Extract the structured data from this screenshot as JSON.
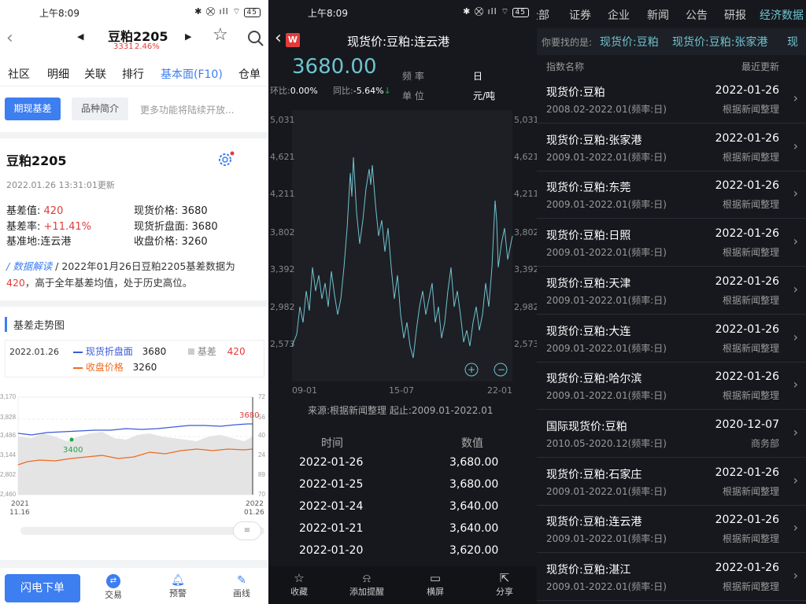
{
  "status": {
    "time": "上午8:09",
    "icons": "✱ ⛒ ıll ⌔",
    "battery": "45"
  },
  "p1": {
    "title": "豆粕2205",
    "price": "3331",
    "change": "2.46%",
    "tabs": [
      "社区",
      "明细",
      "关联",
      "排行",
      "基本面(F10)",
      "仓单"
    ],
    "subbtns": [
      "期现基差",
      "品种简介"
    ],
    "more": "更多功能将陆续开放...",
    "heading": "豆粕2205",
    "updated": "2022.01.26 13:31:01更新",
    "kv": {
      "basis_label": "基差值:",
      "basis": "420",
      "rate_label": "基差率:",
      "rate": "+11.41%",
      "place_label": "基准地:",
      "place": "连云港",
      "spot_label": "现货价格:",
      "spot": "3680",
      "spot_disc_label": "现货折盘面:",
      "spot_disc": "3680",
      "close_label": "收盘价格:",
      "close": "3260"
    },
    "analysis_label": "数据解读",
    "analysis_text": "2022年01月26日豆粕2205基差数据为",
    "analysis_hl": "420",
    "analysis_text2": "，高于全年基差均值，处于历史高位。",
    "trend_title": "基差走势图",
    "legend_date": "2022.01.26",
    "legend": [
      {
        "name": "现货折盘面",
        "value": "3680",
        "color": "#3b5bd6"
      },
      {
        "name": "基差",
        "value": "420",
        "color": "#cccccc"
      },
      {
        "name": "收盘价格",
        "value": "3260",
        "color": "#f06a1e"
      }
    ],
    "left_ticks": [
      "3,170",
      "3,828",
      "3,486",
      "3,144",
      "2,802",
      "2,460"
    ],
    "right_ticks": [
      "72",
      "56",
      "40",
      "24",
      "89",
      "70"
    ],
    "x_ticks": [
      [
        "2021",
        "11.16"
      ],
      [
        "2022",
        "01.26"
      ]
    ],
    "mark_3680": "3680",
    "mark_3400": "3400",
    "bottom": {
      "primary": "闪电下单",
      "items": [
        "交易",
        "预警",
        "画线"
      ]
    }
  },
  "p2": {
    "title": "现货价:豆粕:连云港",
    "logo": "W",
    "price": "3680.00",
    "hb_label": "环比:",
    "hb": "0.00%",
    "tb_label": "同比:",
    "tb": "-5.64%",
    "freq_label": "频 率",
    "freq": "日",
    "unit_label": "单 位",
    "unit": "元/吨",
    "y_ticks": [
      "5,031",
      "4,621",
      "4,211",
      "3,802",
      "3,392",
      "2,982",
      "2,573"
    ],
    "x_ticks": [
      "09-01",
      "15-07",
      "22-01"
    ],
    "source": "来源:根据新闻整理 起止:2009.01-2022.01",
    "col_time": "时间",
    "col_value": "数值",
    "rows": [
      [
        "2022-01-26",
        "3,680.00"
      ],
      [
        "2022-01-25",
        "3,680.00"
      ],
      [
        "2022-01-24",
        "3,640.00"
      ],
      [
        "2022-01-21",
        "3,640.00"
      ],
      [
        "2022-01-20",
        "3,620.00"
      ]
    ],
    "bottom": [
      "收藏",
      "添加提醒",
      "横屏",
      "分享"
    ]
  },
  "p3": {
    "tabs": [
      "全部",
      "证券",
      "企业",
      "新闻",
      "公告",
      "研报",
      "经济数据"
    ],
    "search_label": "你要找的是:",
    "suggest": [
      "现货价:豆粕",
      "现货价:豆粕:张家港",
      "现"
    ],
    "col_name": "指数名称",
    "col_update": "最近更新",
    "rows": [
      {
        "name": "现货价:豆粕",
        "sub": "2008.02-2022.01(频率:日)",
        "date": "2022-01-26",
        "src": "根据新闻整理"
      },
      {
        "name": "现货价:豆粕:张家港",
        "sub": "2009.01-2022.01(频率:日)",
        "date": "2022-01-26",
        "src": "根据新闻整理"
      },
      {
        "name": "现货价:豆粕:东莞",
        "sub": "2009.01-2022.01(频率:日)",
        "date": "2022-01-26",
        "src": "根据新闻整理"
      },
      {
        "name": "现货价:豆粕:日照",
        "sub": "2009.01-2022.01(频率:日)",
        "date": "2022-01-26",
        "src": "根据新闻整理"
      },
      {
        "name": "现货价:豆粕:天津",
        "sub": "2009.01-2022.01(频率:日)",
        "date": "2022-01-26",
        "src": "根据新闻整理"
      },
      {
        "name": "现货价:豆粕:大连",
        "sub": "2009.01-2022.01(频率:日)",
        "date": "2022-01-26",
        "src": "根据新闻整理"
      },
      {
        "name": "现货价:豆粕:哈尔滨",
        "sub": "2009.01-2022.01(频率:日)",
        "date": "2022-01-26",
        "src": "根据新闻整理"
      },
      {
        "name": "国际现货价:豆粕",
        "sub": "2010.05-2020.12(频率:日)",
        "date": "2020-12-07",
        "src": "商务部"
      },
      {
        "name": "现货价:豆粕:石家庄",
        "sub": "2009.01-2022.01(频率:日)",
        "date": "2022-01-26",
        "src": "根据新闻整理"
      },
      {
        "name": "现货价:豆粕:连云港",
        "sub": "2009.01-2022.01(频率:日)",
        "date": "2022-01-26",
        "src": "根据新闻整理"
      },
      {
        "name": "现货价:豆粕:湛江",
        "sub": "2009.01-2022.01(频率:日)",
        "date": "2022-01-26",
        "src": "根据新闻整理"
      }
    ]
  },
  "colors": {
    "accent_blue": "#3d7ef0",
    "red": "#e23b3b",
    "teal": "#6fc3d0",
    "green": "#1ea64a",
    "orange": "#f06a1e"
  }
}
